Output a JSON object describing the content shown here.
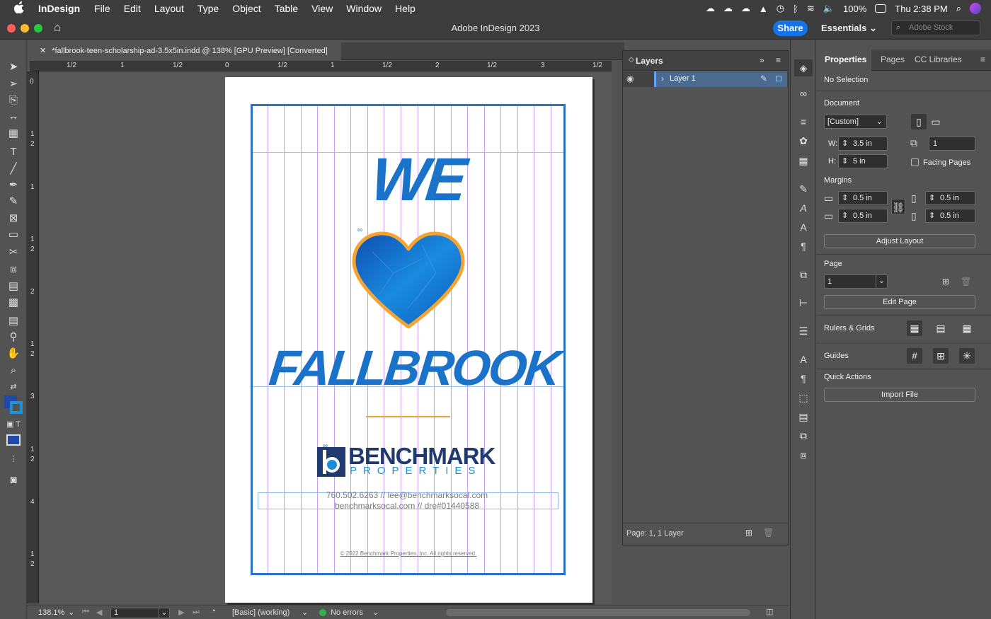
{
  "menubar": {
    "app": "InDesign",
    "items": [
      "File",
      "Edit",
      "Layout",
      "Type",
      "Object",
      "Table",
      "View",
      "Window",
      "Help"
    ],
    "battery": "100%",
    "clock": "Thu 2:38 PM"
  },
  "window": {
    "title": "Adobe InDesign 2023",
    "share": "Share",
    "workspace": "Essentials",
    "stock_placeholder": "Adobe Stock"
  },
  "document": {
    "tab": "*fallbrook-teen-scholarship-ad-3.5x5in.indd @ 138% [GPU Preview] [Converted]"
  },
  "rulers": {
    "h": [
      "1/2",
      "1",
      "1/2",
      "0",
      "1/2",
      "1",
      "1/2",
      "2",
      "1/2",
      "3",
      "1/2"
    ],
    "v": [
      "0",
      "1",
      "2",
      "1",
      "1",
      "2",
      "2",
      "1",
      "2",
      "3",
      "1",
      "2",
      "4",
      "1",
      "2"
    ]
  },
  "ad": {
    "headline1": "WE",
    "headline2": "FALLBROOK",
    "logo_main": "BENCHMARK",
    "logo_sub": "PROPERTIES",
    "contact_line1": "760.502.6263  //  lee@benchmarksocal.com",
    "contact_line2": "benchmarksocal.com  //  dre#01440588",
    "copyright": "© 2022 Benchmark Properties, Inc. All rights reserved.",
    "colors": {
      "blue": "#1a73c9",
      "navy": "#1f3a6e",
      "orange": "#f0a030"
    }
  },
  "status": {
    "zoom": "138.1%",
    "page": "1",
    "style": "[Basic] (working)",
    "errors": "No errors"
  },
  "layers": {
    "title": "Layers",
    "layer": "Layer 1",
    "footer": "Page: 1, 1 Layer"
  },
  "properties": {
    "tabs": [
      "Properties",
      "Pages",
      "CC Libraries"
    ],
    "selection": "No Selection",
    "document_label": "Document",
    "preset": "[Custom]",
    "w_label": "W:",
    "width": "3.5 in",
    "h_label": "H:",
    "height": "5 in",
    "pages": "1",
    "facing": "Facing Pages",
    "margins_label": "Margins",
    "margins": [
      "0.5 in",
      "0.5 in",
      "0.5 in",
      "0.5 in"
    ],
    "adjust": "Adjust Layout",
    "page_label": "Page",
    "page_value": "1",
    "edit_page": "Edit Page",
    "rulers_grids": "Rulers & Grids",
    "guides": "Guides",
    "quick_actions": "Quick Actions",
    "import": "Import File"
  }
}
